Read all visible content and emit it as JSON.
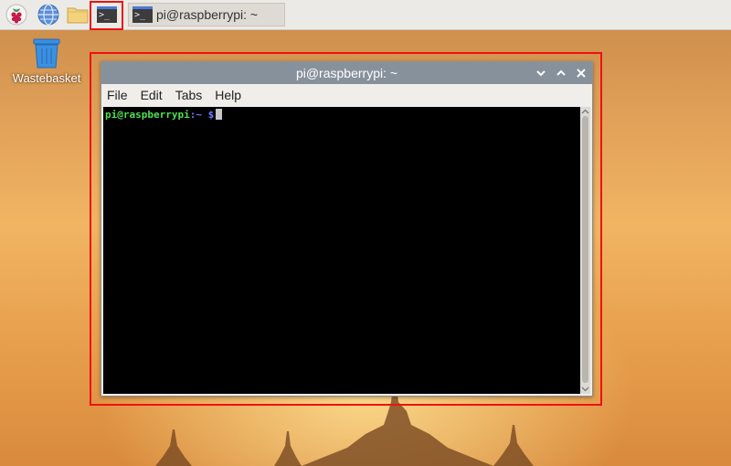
{
  "taskbar": {
    "launchers": [
      {
        "name": "raspberry-menu-icon"
      },
      {
        "name": "web-browser-icon"
      },
      {
        "name": "file-manager-icon"
      },
      {
        "name": "terminal-icon"
      }
    ],
    "terminal_glyph": ">_",
    "task": {
      "label": "pi@raspberrypi: ~",
      "glyph": ">_"
    }
  },
  "desktop": {
    "icons": [
      {
        "label": "Wastebasket"
      }
    ]
  },
  "window": {
    "title": "pi@raspberrypi: ~",
    "menu": [
      "File",
      "Edit",
      "Tabs",
      "Help"
    ],
    "prompt": {
      "user_host": "pi@raspberrypi",
      "colon": ":",
      "path": "~",
      "symbol": " $"
    }
  },
  "colors": {
    "highlight": "#ee1111",
    "titlebar": "#87919c",
    "prompt_user": "#4ee04e",
    "prompt_path": "#6b7cff"
  }
}
